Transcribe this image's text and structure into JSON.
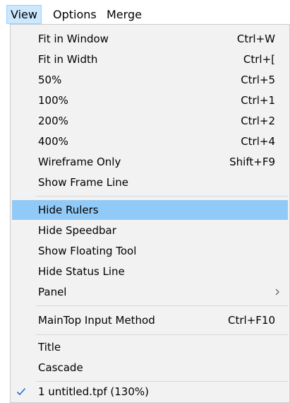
{
  "menubar": {
    "items": [
      "View",
      "Options",
      "Merge"
    ]
  },
  "view_menu": {
    "fit_in_window": {
      "label": "Fit in Window",
      "shortcut": "Ctrl+W"
    },
    "fit_in_width": {
      "label": "Fit in Width",
      "shortcut": "Ctrl+["
    },
    "zoom_50": {
      "label": "50%",
      "shortcut": "Ctrl+5"
    },
    "zoom_100": {
      "label": "100%",
      "shortcut": "Ctrl+1"
    },
    "zoom_200": {
      "label": "200%",
      "shortcut": "Ctrl+2"
    },
    "zoom_400": {
      "label": "400%",
      "shortcut": "Ctrl+4"
    },
    "wireframe_only": {
      "label": "Wireframe Only",
      "shortcut": "Shift+F9"
    },
    "show_frame_line": {
      "label": "Show Frame Line"
    },
    "hide_rulers": {
      "label": "Hide Rulers"
    },
    "hide_speedbar": {
      "label": "Hide Speedbar"
    },
    "show_floating_tool": {
      "label": "Show Floating Tool"
    },
    "hide_status_line": {
      "label": "Hide Status Line"
    },
    "panel": {
      "label": "Panel",
      "submenu_icon": "chevron-right-icon"
    },
    "maintop_input_method": {
      "label": "MainTop Input Method",
      "shortcut": "Ctrl+F10"
    },
    "title": {
      "label": "Title"
    },
    "cascade": {
      "label": "Cascade"
    },
    "window_1": {
      "label": "1 untitled.tpf (130%)",
      "checked": true,
      "check_icon": "checkmark-icon"
    }
  },
  "colors": {
    "menu_bg": "#f2f2f2",
    "highlight": "#91c9f7",
    "menubar_active": "#cce8ff",
    "check": "#1f6fd1"
  }
}
